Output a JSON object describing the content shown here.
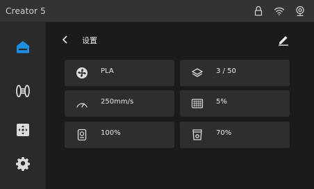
{
  "statusbar": {
    "title": "Creator 5",
    "icons": [
      "lock-icon",
      "wifi-icon",
      "webcam-icon"
    ]
  },
  "sidebar": {
    "items": [
      {
        "name": "home",
        "icon": "home-icon",
        "active": true
      },
      {
        "name": "filament",
        "icon": "filament-spool-icon",
        "active": false
      },
      {
        "name": "move",
        "icon": "move-axes-icon",
        "active": false
      },
      {
        "name": "settings",
        "icon": "gear-icon",
        "active": false
      }
    ]
  },
  "header": {
    "title": "设置",
    "back_icon": "chevron-left-icon",
    "edit_icon": "pencil-icon"
  },
  "cards": [
    {
      "icon": "fan-icon",
      "value": "PLA"
    },
    {
      "icon": "layers-icon",
      "value": "3 / 50"
    },
    {
      "icon": "speedometer-icon",
      "value": "250mm/s"
    },
    {
      "icon": "infill-icon",
      "value": "5%"
    },
    {
      "icon": "flow-rate-icon",
      "value": "100%"
    },
    {
      "icon": "cooling-icon",
      "value": "70%"
    }
  ],
  "colors": {
    "accent": "#1e8fe0",
    "card": "#2e2e2e",
    "sidebar": "#2a2a2a",
    "statusbar": "#333333"
  }
}
